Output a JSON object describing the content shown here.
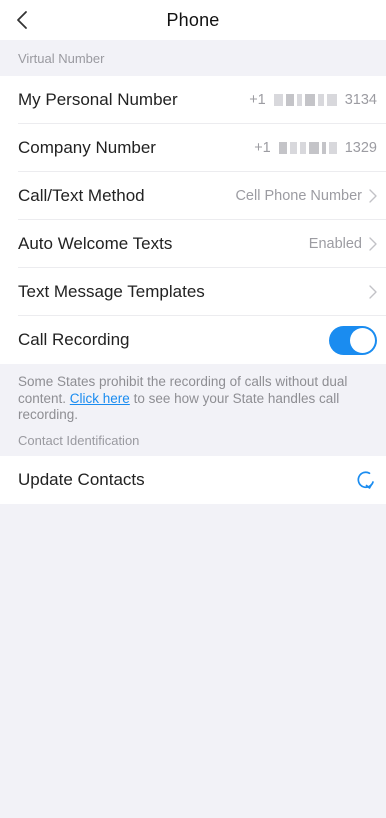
{
  "header": {
    "title": "Phone",
    "back_icon": "chevron-left-icon"
  },
  "virtual_number": {
    "section_title": "Virtual Number",
    "rows": [
      {
        "label": "My Personal Number",
        "prefix": "+1",
        "suffix": "3134"
      },
      {
        "label": "Company Number",
        "prefix": "+1",
        "suffix": "1329"
      },
      {
        "label": "Call/Text Method",
        "value": "Cell Phone Number"
      },
      {
        "label": "Auto Welcome Texts",
        "value": "Enabled"
      },
      {
        "label": "Text Message Templates",
        "value": ""
      },
      {
        "label": "Call Recording",
        "toggle_on": true
      }
    ]
  },
  "note": {
    "before": "Some States prohibit the recording of calls without dual content. ",
    "link": "Click here",
    "after": " to see how your State handles call recording."
  },
  "contact_identification": {
    "section_title": "Contact Identification",
    "update_label": "Update Contacts",
    "icon": "refresh-icon"
  },
  "colors": {
    "accent": "#1a8cf0",
    "background": "#f2f2f7"
  }
}
